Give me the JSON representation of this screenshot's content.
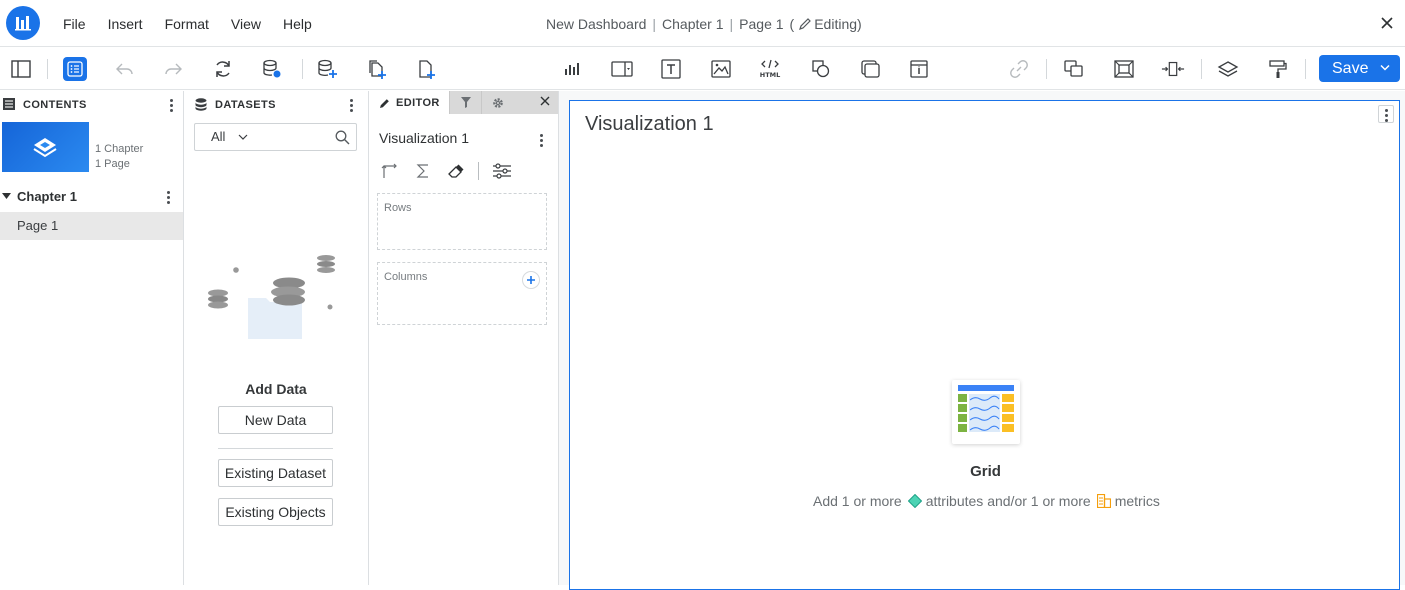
{
  "menubar": {
    "items": [
      "File",
      "Insert",
      "Format",
      "View",
      "Help"
    ],
    "doc_title": "New Dashboard",
    "chapter": "Chapter 1",
    "page": "Page 1",
    "editing_open": "(",
    "editing_label": "Editing)",
    "separator": "|"
  },
  "toolbar": {
    "save_label": "Save",
    "accent_color": "#1a73e8"
  },
  "contents": {
    "header": "CONTENTS",
    "meta_chapters": "1 Chapter",
    "meta_pages": "1 Page",
    "chapter_label": "Chapter 1",
    "page_label": "Page 1"
  },
  "datasets": {
    "header": "DATASETS",
    "filter_value": "All",
    "add_data_title": "Add Data",
    "new_data_label": "New Data",
    "existing_dataset_label": "Existing Dataset",
    "existing_objects_label": "Existing Objects"
  },
  "editor": {
    "tab_label": "EDITOR",
    "viz_name": "Visualization 1",
    "rows_label": "Rows",
    "columns_label": "Columns"
  },
  "canvas": {
    "viz_title": "Visualization 1",
    "grid_label": "Grid",
    "hint_prefix": "Add 1 or more",
    "hint_mid": "attributes and/or 1 or more",
    "hint_suffix": "metrics"
  }
}
